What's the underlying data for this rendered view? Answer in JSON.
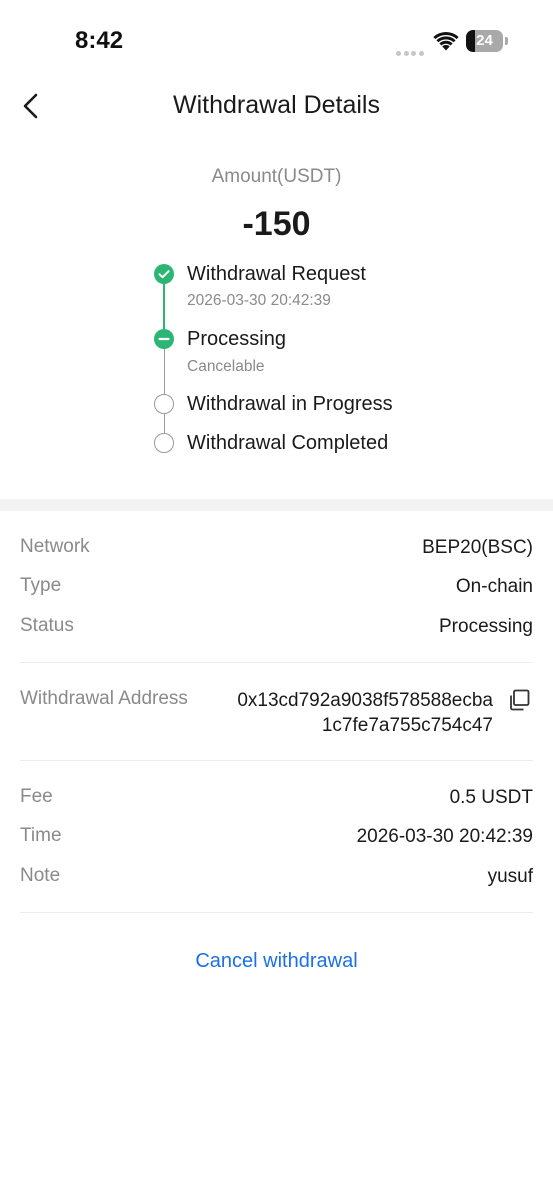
{
  "status_bar": {
    "time": "8:42",
    "battery_level": "24",
    "battery_fraction": 0.24
  },
  "header": {
    "title": "Withdrawal Details",
    "back_icon": "chevron-left-icon"
  },
  "amount": {
    "label": "Amount(USDT)",
    "value": "-150"
  },
  "timeline": {
    "steps": [
      {
        "title": "Withdrawal Request",
        "subtitle": "2026-03-30 20:42:39",
        "state": "done",
        "icon": "check-circle-icon"
      },
      {
        "title": "Processing",
        "subtitle": "Cancelable",
        "state": "current",
        "icon": "minus-circle-icon"
      },
      {
        "title": "Withdrawal in Progress",
        "subtitle": "",
        "state": "pending",
        "icon": "empty-circle-icon"
      },
      {
        "title": "Withdrawal Completed",
        "subtitle": "",
        "state": "pending",
        "icon": "empty-circle-icon"
      }
    ],
    "colors": {
      "done": "#2bb673",
      "pending_border": "#9a9a9a",
      "line_inactive": "#9a9a9a"
    }
  },
  "details": {
    "network": {
      "label": "Network",
      "value": "BEP20(BSC)"
    },
    "type": {
      "label": "Type",
      "value": "On-chain"
    },
    "status": {
      "label": "Status",
      "value": "Processing"
    },
    "address": {
      "label": "Withdrawal Address",
      "value": "0x13cd792a9038f578588ecba1c7fe7a755c754c47",
      "line1": "0x13cd792a9038f578588ecba",
      "line2": "1c7fe7a755c754c47",
      "copy_icon": "copy-icon"
    },
    "fee": {
      "label": "Fee",
      "value": "0.5 USDT"
    },
    "time": {
      "label": "Time",
      "value": "2026-03-30 20:42:39"
    },
    "note": {
      "label": "Note",
      "value": "yusuf"
    }
  },
  "actions": {
    "cancel_label": "Cancel withdrawal",
    "link_color": "#1b6fe8"
  }
}
